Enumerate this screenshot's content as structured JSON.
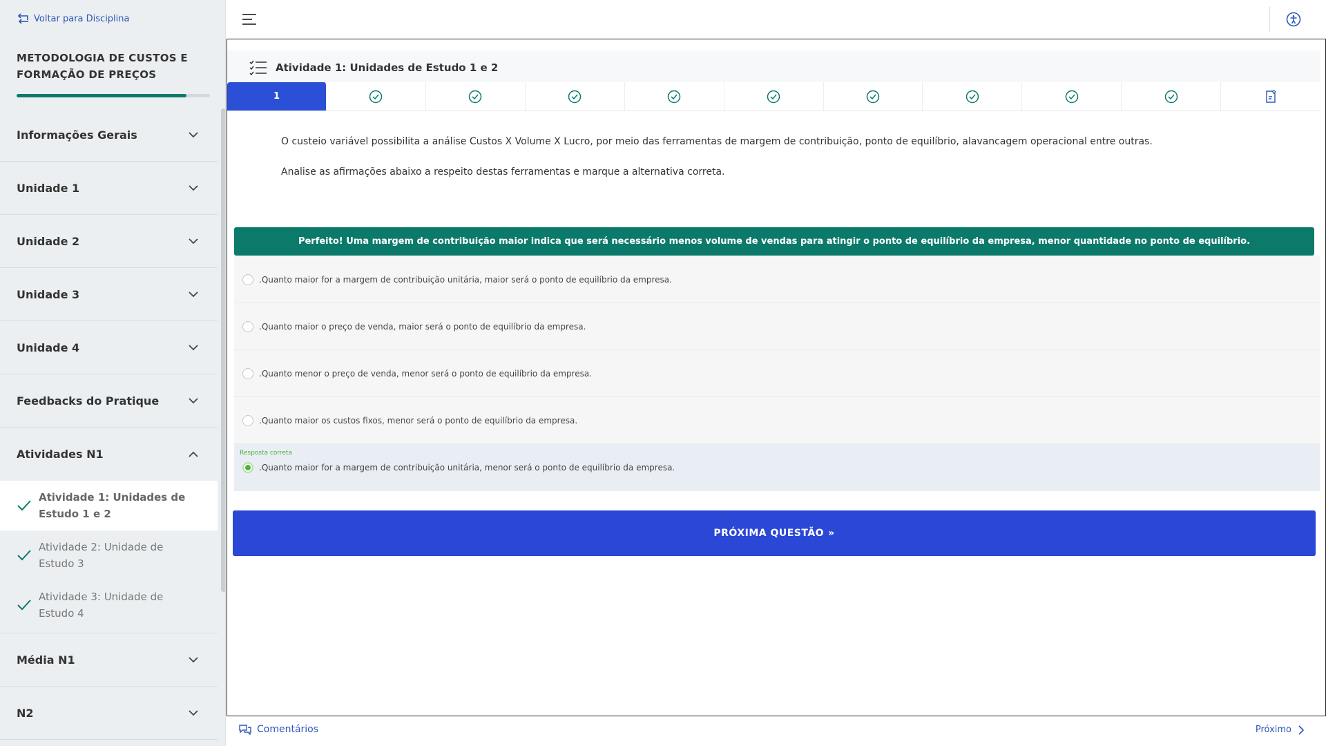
{
  "sidebar": {
    "back_label": "Voltar para Disciplina",
    "course_title": "METODOLOGIA DE CUSTOS E FORMAÇÃO DE PREÇOS",
    "progress_percent": 88,
    "sections": [
      {
        "label": "Informações Gerais",
        "expanded": false
      },
      {
        "label": "Unidade 1",
        "expanded": false
      },
      {
        "label": "Unidade 2",
        "expanded": false
      },
      {
        "label": "Unidade 3",
        "expanded": false
      },
      {
        "label": "Unidade 4",
        "expanded": false
      },
      {
        "label": "Feedbacks do Pratique",
        "expanded": false
      },
      {
        "label": "Atividades N1",
        "expanded": true
      },
      {
        "label": "Média N1",
        "expanded": false
      },
      {
        "label": "N2",
        "expanded": false
      }
    ],
    "sub_items": [
      {
        "label": "Atividade 1: Unidades de Estudo 1 e 2",
        "active": true,
        "completed": true
      },
      {
        "label": "Atividade 2: Unidade de Estudo 3",
        "active": false,
        "completed": true
      },
      {
        "label": "Atividade 3: Unidade de Estudo 4",
        "active": false,
        "completed": true
      }
    ]
  },
  "activity": {
    "title": "Atividade 1: Unidades de Estudo 1 e 2",
    "active_question": "1",
    "question_status_icons": [
      "check-circle-icon",
      "check-circle-icon",
      "check-circle-icon",
      "check-circle-icon",
      "check-circle-icon",
      "check-circle-icon",
      "check-circle-icon",
      "check-circle-icon",
      "check-circle-icon",
      "check-circle-icon"
    ],
    "final_tab_icon": "edit-doc-icon"
  },
  "question": {
    "paragraph_1": "O custeio variável possibilita a análise Custos X Volume X Lucro, por meio das ferramentas de margem de contribuição, ponto de equilíbrio, alavancagem operacional entre outras.",
    "paragraph_2": "Analise as afirmações abaixo a respeito destas ferramentas e marque a alternativa correta."
  },
  "feedback": "Perfeito! Uma margem de contribuição maior indica que será necessário menos volume de vendas para atingir o ponto de equilíbrio da empresa, menor quantidade no ponto de equilíbrio.",
  "options": [
    ".Quanto maior for a margem de contribuição unitária, maior será o ponto de equilíbrio da empresa.",
    ".Quanto maior o preço de venda, maior será o ponto de equilíbrio da empresa.",
    ".Quanto menor o preço de venda, menor será o ponto de equilíbrio da empresa.",
    ".Quanto maior os custos fixos, menor será o ponto de equilíbrio da empresa.",
    ".Quanto maior for a margem de contribuição unitária, menor será o ponto de equilíbrio da empresa."
  ],
  "correct_label": "Resposta correta",
  "next_question_label": "PRÓXIMA QUESTÃO",
  "bottom": {
    "comments_label": "Comentários",
    "next_label": "Próximo"
  },
  "colors": {
    "primary": "#2b47d6",
    "accent_green": "#0b7a6b",
    "correct_green": "#4bb43a",
    "link": "#2b56b8"
  }
}
